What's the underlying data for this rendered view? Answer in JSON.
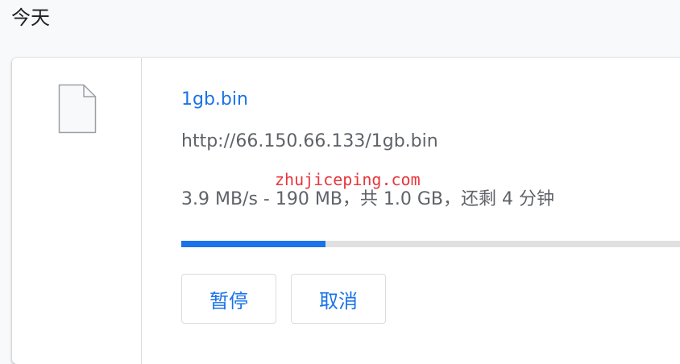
{
  "section": {
    "heading": "今天"
  },
  "download": {
    "icon": "file-icon",
    "file_name": "1gb.bin",
    "url": "http://66.150.66.133/1gb.bin",
    "status": "3.9 MB/s - 190 MB，共 1.0 GB，还剩 4 分钟",
    "progress_fraction": 0.28,
    "buttons": {
      "pause_label": "暂停",
      "cancel_label": "取消"
    }
  },
  "watermark": {
    "text": "zhujiceping.com"
  },
  "colors": {
    "accent": "#1a73e8",
    "progress_track": "#e0e0e0",
    "watermark": "#e8363b",
    "secondary_text": "#5f6368"
  }
}
